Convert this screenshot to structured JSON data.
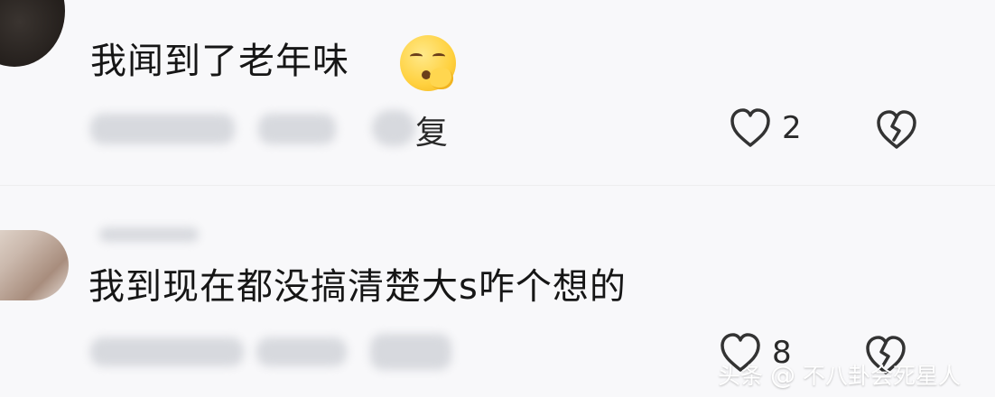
{
  "comments": [
    {
      "text": "我闻到了老年味",
      "reply_label": "复",
      "likes": "2"
    },
    {
      "text": "我到现在都没搞清楚大s咋个想的",
      "reply_label": "",
      "likes": "8"
    }
  ],
  "watermark": {
    "source": "头条",
    "at": "@",
    "name": "不八卦会死星人"
  },
  "colors": {
    "background": "#f8f8fa",
    "text": "#161616",
    "icons": "#333333",
    "watermark_text": "#ffffff"
  },
  "icons": {
    "like": "heart-icon",
    "dislike": "broken-heart-icon",
    "emoji": "hushed-emoji-icon"
  }
}
